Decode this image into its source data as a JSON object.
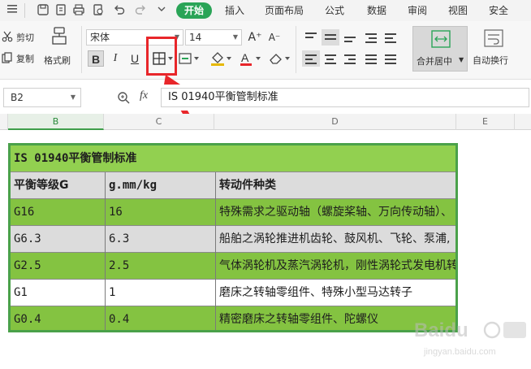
{
  "menubar": {
    "quick_icons": [
      "hamburger-icon",
      "save-icon",
      "print-icon",
      "print-preview-icon",
      "undo-icon",
      "redo-icon",
      "customize-icon"
    ],
    "tabs": [
      "开始",
      "插入",
      "页面布局",
      "公式",
      "数据",
      "审阅",
      "视图",
      "安全"
    ],
    "active_tab": "开始"
  },
  "ribbon": {
    "cut": "剪切",
    "copy": "复制",
    "format_painter": "格式刷",
    "font_name": "宋体",
    "font_size": "14",
    "bold": "B",
    "italic": "I",
    "underline": "U",
    "font_color_letter": "A",
    "grow_font": "A⁺",
    "shrink_font": "A⁻",
    "merge_center": "合并居中",
    "wrap_text": "自动换行"
  },
  "formula_bar": {
    "name_box": "B2",
    "fx": "fx",
    "formula": "IS 01940平衡管制标准"
  },
  "columns": {
    "headers": [
      "B",
      "C",
      "D",
      "E"
    ],
    "selected": "B"
  },
  "table": {
    "title": "IS 01940平衡管制标准",
    "headers": [
      "平衡等级G",
      "g.mm/kg",
      "转动件种类"
    ],
    "rows": [
      {
        "grade": "G16",
        "value": "16",
        "type": "特殊需求之驱动轴（螺旋桨轴、万向传动轴）、",
        "band": "green"
      },
      {
        "grade": "G6.3",
        "value": "6.3",
        "type": "船舶之涡轮推进机齿轮、鼓风机、飞轮、泵浦,",
        "band": "gray"
      },
      {
        "grade": "G2.5",
        "value": "2.5",
        "type": "气体涡轮机及蒸汽涡轮机，刚性涡轮式发电机转",
        "band": "green"
      },
      {
        "grade": "G1",
        "value": "1",
        "type": "磨床之转轴零组件、特殊小型马达转子",
        "band": "white"
      },
      {
        "grade": "G0.4",
        "value": "0.4",
        "type": "精密磨床之转轴零组件、陀螺仪",
        "band": "green"
      }
    ]
  },
  "colors": {
    "accent": "#2aa457",
    "header_green": "#92d050",
    "row_green": "#84c341",
    "row_gray": "#dcdcdc",
    "highlight_red": "#e8262a"
  },
  "watermark": {
    "brand": "Baidu",
    "subtitle": "jingyan.baidu.com"
  }
}
